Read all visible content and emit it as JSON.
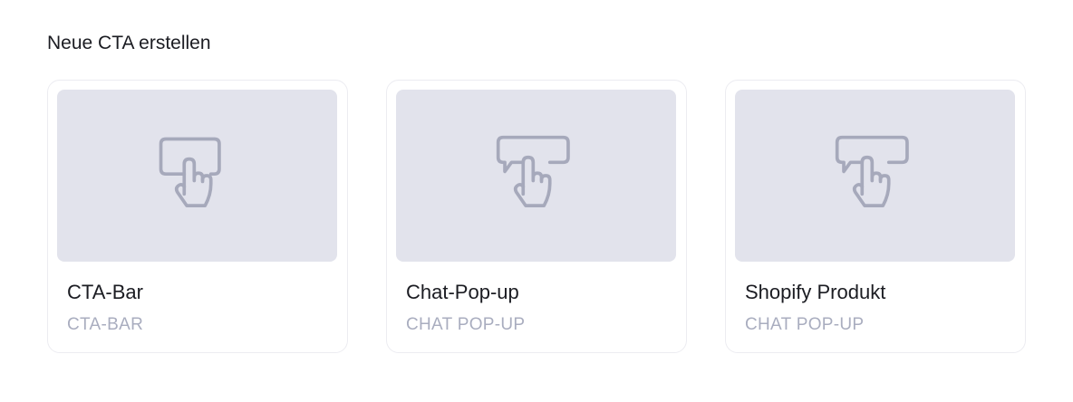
{
  "section": {
    "title": "Neue CTA erstellen"
  },
  "colors": {
    "preview_bg": "#e2e3ec",
    "icon_stroke": "#a6a9bb",
    "subtitle": "#a9adbf"
  },
  "cards": [
    {
      "title": "CTA-Bar",
      "subtitle": "CTA-BAR",
      "icon": "tap-button-icon"
    },
    {
      "title": "Chat-Pop-up",
      "subtitle": "CHAT POP-UP",
      "icon": "chat-tap-icon"
    },
    {
      "title": "Shopify Produkt",
      "subtitle": "CHAT POP-UP",
      "icon": "chat-tap-icon"
    }
  ]
}
